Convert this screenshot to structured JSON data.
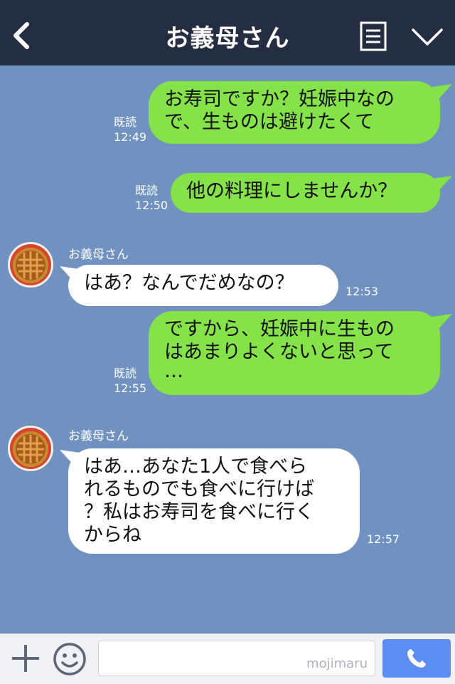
{
  "header": {
    "title": "お義母さん",
    "back_icon": "chevron-left-icon",
    "menu_icon": "menu-list-icon",
    "more_icon": "chevron-down-icon"
  },
  "colors": {
    "background": "#7192c1",
    "header": "#242d42",
    "outgoing_bubble": "#85e249",
    "incoming_bubble": "#ffffff",
    "send_button": "#5b8ef0"
  },
  "messages": [
    {
      "direction": "out",
      "lines": [
        "お寿司ですか？妊娠中なの",
        "で、生ものは避けたくて"
      ],
      "read": "既読",
      "time": "12:49"
    },
    {
      "direction": "out",
      "lines": [
        "他の料理にしませんか？"
      ],
      "read": "既読",
      "time": "12:50"
    },
    {
      "direction": "in",
      "sender": "お義母さん",
      "lines": [
        "はあ？なんでだめなの？"
      ],
      "time": "12:53"
    },
    {
      "direction": "out",
      "lines": [
        "ですから、妊娠中に生もの",
        "はあまりよくないと思って",
        "…"
      ],
      "read": "既読",
      "time": "12:55"
    },
    {
      "direction": "in",
      "sender": "お義母さん",
      "lines": [
        "はあ…あなた1人で食べら",
        "れるものでも食べに行けば",
        "？私はお寿司を食べに行く",
        "からね"
      ],
      "time": "12:57"
    }
  ],
  "input": {
    "value": "",
    "watermark": "mojimaru",
    "plus_icon": "plus-icon",
    "sticker_icon": "smiley-icon",
    "call_icon": "phone-icon"
  }
}
